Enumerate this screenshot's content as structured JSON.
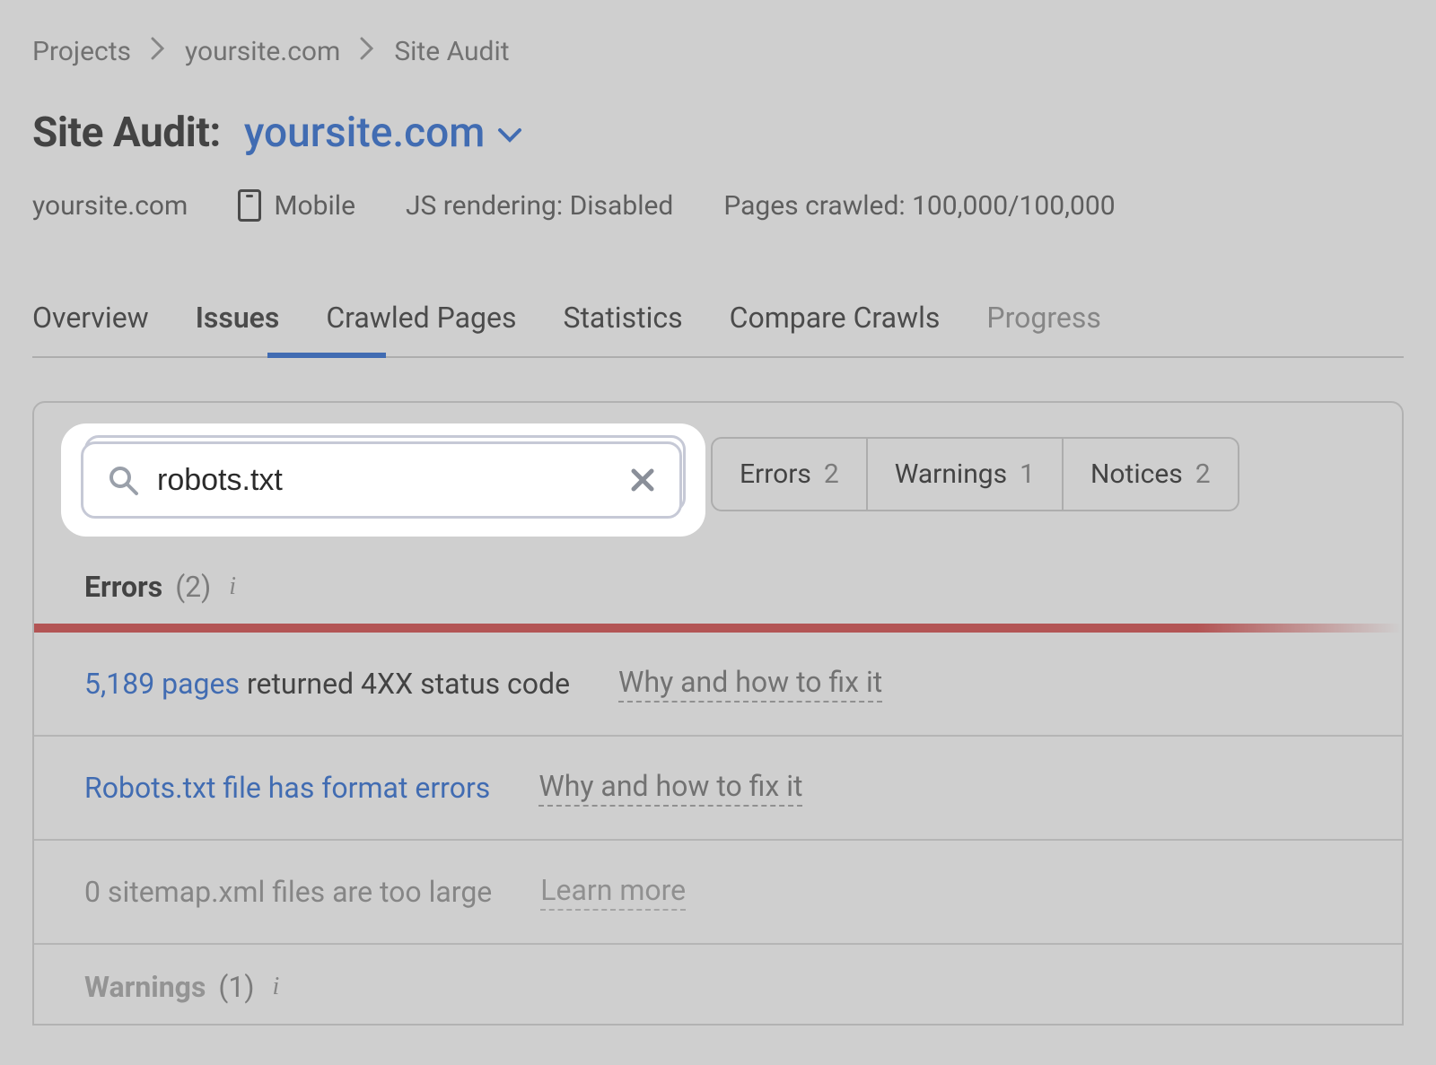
{
  "breadcrumb": {
    "items": [
      "Projects",
      "yoursite.com",
      "Site Audit"
    ]
  },
  "title": {
    "prefix": "Site Audit:",
    "domain": "yoursite.com"
  },
  "meta": {
    "domain": "yoursite.com",
    "device": "Mobile",
    "js_rendering": "JS rendering: Disabled",
    "pages_crawled": "Pages crawled: 100,000/100,000"
  },
  "tabs": [
    "Overview",
    "Issues",
    "Crawled Pages",
    "Statistics",
    "Compare Crawls",
    "Progress"
  ],
  "active_tab_index": 1,
  "search": {
    "value": "robots.txt"
  },
  "category_pills": [
    {
      "label": "Errors",
      "count": "2"
    },
    {
      "label": "Warnings",
      "count": "1"
    },
    {
      "label": "Notices",
      "count": "2"
    }
  ],
  "sections": {
    "errors": {
      "label": "Errors",
      "count": "(2)",
      "rows": [
        {
          "link_text": "5,189 pages",
          "rest": " returned 4XX status code",
          "fix": "Why and how to fix it",
          "faded": false
        },
        {
          "link_text": "Robots.txt file has format errors",
          "rest": "",
          "fix": "Why and how to fix it",
          "faded": false
        },
        {
          "link_text": "0 sitemap.xml files are too large",
          "rest": "",
          "fix": "Learn more",
          "faded": true
        }
      ]
    },
    "warnings": {
      "label": "Warnings",
      "count": "(1)"
    }
  },
  "colors": {
    "link": "#1a5fd0",
    "error_bar": "#d23a3a"
  }
}
